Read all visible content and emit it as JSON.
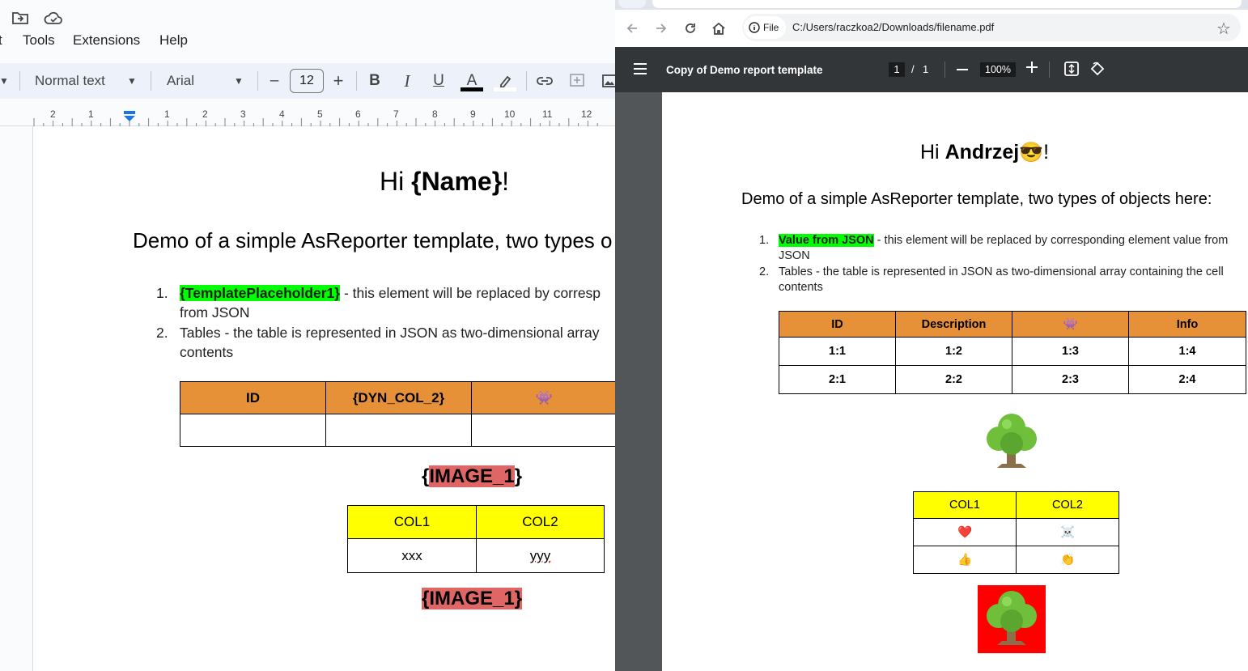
{
  "docs": {
    "menu": [
      "t",
      "Tools",
      "Extensions",
      "Help"
    ],
    "toolbar": {
      "style": "Normal text",
      "font": "Arial",
      "font_size": "12",
      "minus": "–",
      "plus": "+",
      "bold": "B",
      "italic": "I",
      "underline": "U",
      "text_color": "A"
    },
    "ruler_numbers": [
      "2",
      "1",
      "1",
      "2",
      "3",
      "4",
      "5",
      "6",
      "7",
      "8",
      "9",
      "10",
      "11",
      "12"
    ],
    "document": {
      "title_pre": "Hi ",
      "title_name": "{Name}",
      "title_post": "!",
      "subtitle": "Demo of a simple AsReporter template, two types o",
      "list": [
        {
          "num": "1.",
          "highlight": "{TemplatePlaceholder1}",
          "text": " - this element will be replaced by corresp",
          "continuation": "from JSON"
        },
        {
          "num": "2.",
          "lead": "Tables",
          "text": " - the table is represented in JSON as two-dimensional array",
          "continuation": "contents"
        }
      ],
      "table1": {
        "headers": [
          "ID",
          "{DYN_COL_2}",
          "👾"
        ],
        "header_color": "#e69138"
      },
      "image_placeholder_1": {
        "open": "{",
        "inner": "IMAGE_1",
        "close": "}"
      },
      "table2": {
        "headers": [
          "COL1",
          "COL2"
        ],
        "row": [
          "xxx",
          "yyy"
        ],
        "header_color": "#ffff00"
      },
      "image_placeholder_2": "{IMAGE_1}"
    }
  },
  "chrome": {
    "omnibox": {
      "chip": "File",
      "url": "C:/Users/raczkoa2/Downloads/filename.pdf"
    },
    "pdf_toolbar": {
      "title": "Copy of Demo report template",
      "page_current": "1",
      "page_sep": "/",
      "page_total": "1",
      "zoom": "100%"
    },
    "pdf": {
      "title_pre": "Hi ",
      "title_name": "Andrzej",
      "title_emoji": "😎",
      "title_post": "!",
      "subtitle": "Demo of a simple AsReporter template, two types of objects here:",
      "list": [
        {
          "num": "1.",
          "highlight": "Value from JSON",
          "text": " - this element will be replaced by corresponding element value from",
          "continuation": "JSON"
        },
        {
          "num": "2.",
          "text": "Tables - the table is represented in JSON as two-dimensional array containing the cell",
          "continuation": "contents"
        }
      ],
      "table1": {
        "headers": [
          "ID",
          "Description",
          "👾",
          "Info"
        ],
        "rows": [
          [
            "1:1",
            "1:2",
            "1:3",
            "1:4"
          ],
          [
            "2:1",
            "2:2",
            "2:3",
            "2:4"
          ]
        ],
        "header_color": "#e69138"
      },
      "table2": {
        "headers": [
          "COL1",
          "COL2"
        ],
        "rows": [
          [
            "❤️",
            "☠️"
          ],
          [
            "👍",
            "👏"
          ]
        ],
        "header_color": "#ffff00"
      },
      "tree_emoji": "🌳",
      "tree_bg_color": "#ff0000"
    }
  }
}
